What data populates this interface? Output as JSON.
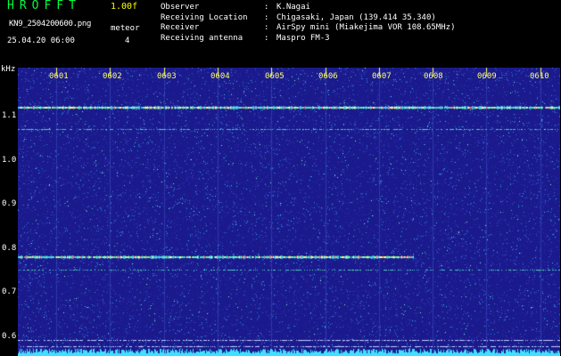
{
  "header": {
    "app_title": "HROFFT",
    "version": "1.00f",
    "filename": "KN9_2504200600.png",
    "mode_label": "meteor",
    "datetime": "25.04.20 06:00",
    "mode_value": "4"
  },
  "meta": [
    {
      "key": "Observer",
      "sep": ":",
      "value": "K.Nagai"
    },
    {
      "key": "Receiving Location",
      "sep": ":",
      "value": "Chigasaki, Japan (139.414 35.340)"
    },
    {
      "key": "Receiver",
      "sep": ":",
      "value": "AirSpy mini (Miakejima VOR 108.65MHz)"
    },
    {
      "key": "Receiving antenna",
      "sep": ":",
      "value": "Maspro FM-3"
    }
  ],
  "spectrogram": {
    "y_unit": "kHz",
    "y_ticks": [
      "1.1",
      "1.0",
      "0.9",
      "0.8",
      "0.7",
      "0.6"
    ],
    "y_range": [
      0.585,
      1.17
    ],
    "x_ticks": [
      "0601",
      "0602",
      "0603",
      "0604",
      "0605",
      "0606",
      "0607",
      "0608",
      "0609",
      "0610"
    ],
    "colors": {
      "background": "#1a1a8c",
      "tick": "#ffff66",
      "trace": "#a0ffb0",
      "hot_trace": "#ff6060",
      "bottom_band": "#40e0ff"
    },
    "traces": [
      {
        "freq": 1.09,
        "strength": 1.0
      },
      {
        "freq": 1.045,
        "strength": 0.5
      },
      {
        "freq": 0.787,
        "strength": 1.0,
        "end_fraction": 0.73
      },
      {
        "freq": 0.76,
        "strength": 0.45
      },
      {
        "freq": 0.618,
        "strength": 0.6
      },
      {
        "freq": 0.605,
        "strength": 0.6
      }
    ]
  }
}
